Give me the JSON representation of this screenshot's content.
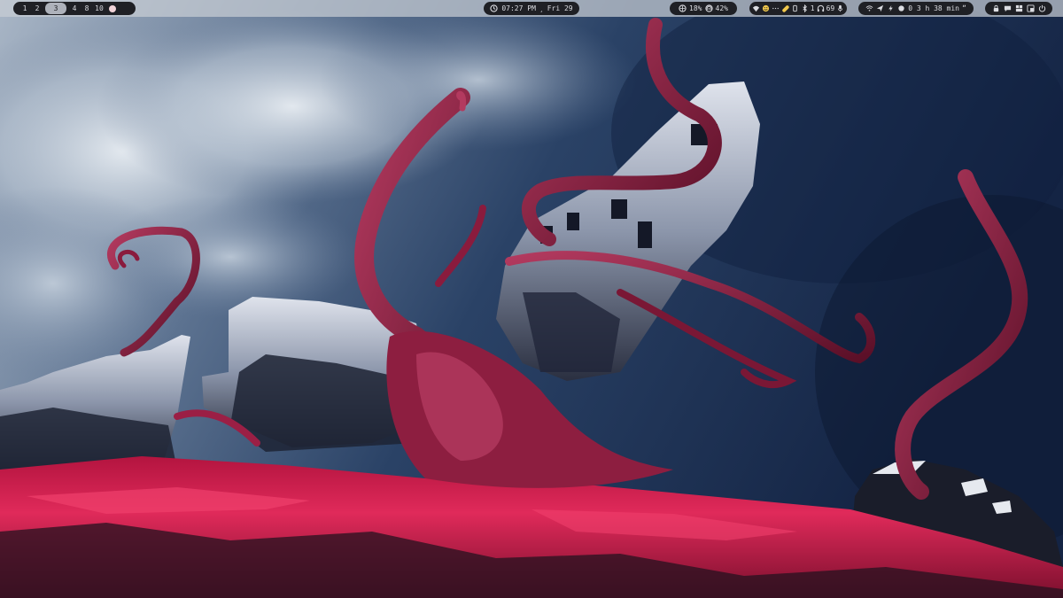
{
  "topbar": {
    "workspaces": [
      {
        "label": "1",
        "active": false
      },
      {
        "label": "2",
        "active": false
      },
      {
        "label": "3",
        "active": true
      },
      {
        "label": "4",
        "active": false
      },
      {
        "label": "8",
        "active": false
      },
      {
        "label": "10",
        "active": false
      }
    ],
    "clock": {
      "time": "07:27 PM",
      "separator": "¸",
      "date": "Fri 29",
      "icon": "clock-icon"
    },
    "resources": {
      "cpu": "18%",
      "memory": "42%",
      "cpu_icon": "cpu-icon",
      "memory_icon": "memory-icon"
    },
    "media": {
      "bluetooth_count": "1",
      "volume": "69",
      "icons": [
        "wifi-icon",
        "emoji-icon",
        "pill-icon",
        "bluetooth-icon",
        "headphones-icon",
        "mic-icon"
      ]
    },
    "network": {
      "uptime": "0 3 h 38 min",
      "suffix": "ˮ",
      "icons": [
        "wifi-icon",
        "send-icon",
        "bolt-icon",
        "battery-icon"
      ]
    },
    "tray": {
      "icons": [
        "lock-icon",
        "chat-icon",
        "layout-icon",
        "screenshot-icon",
        "power-icon"
      ]
    }
  },
  "colors": {
    "bar_bg": "#c8cdd4",
    "pill_bg": "#1f2025",
    "pill_text": "#dcdde2",
    "active_ws": "#aeb2bb",
    "blood": "#d81e4f",
    "tentacle": "#8a1b3d",
    "sky": "#1d3457"
  }
}
